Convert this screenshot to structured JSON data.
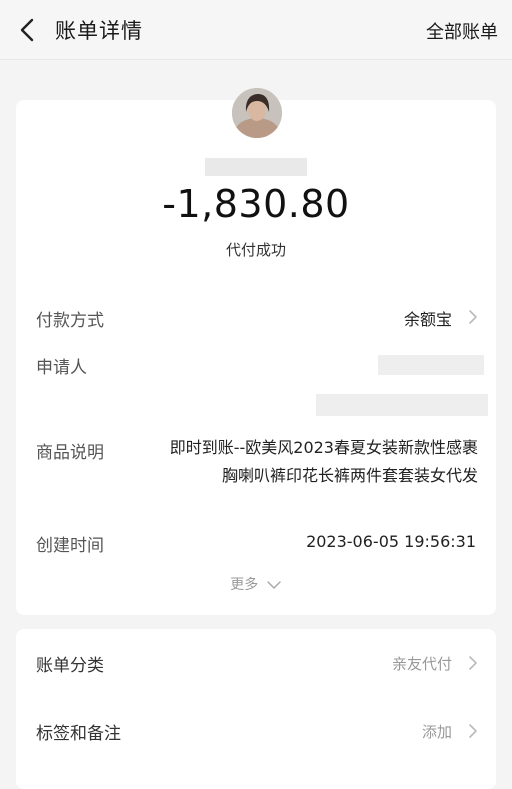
{
  "header": {
    "title": "账单详情",
    "all_bills_label": "全部账单"
  },
  "summary": {
    "amount": "-1,830.80",
    "status": "代付成功"
  },
  "details": {
    "payment_method_label": "付款方式",
    "payment_method_value": "余额宝",
    "applicant_label": "申请人",
    "product_desc_label": "商品说明",
    "product_desc_line1": "即时到账--欧美风2023春夏女装新款性感裹",
    "product_desc_line2": "胸喇叭裤印花长裤两件套套装女代发",
    "created_time_label": "创建时间",
    "created_time_value": "2023-06-05 19:56:31",
    "more_label": "更多"
  },
  "extra": {
    "category_label": "账单分类",
    "category_value": "亲友代付",
    "tags_label": "标签和备注",
    "tags_value": "添加"
  },
  "icons": [
    "back-icon",
    "chevron-right-icon",
    "chevron-down-icon"
  ]
}
